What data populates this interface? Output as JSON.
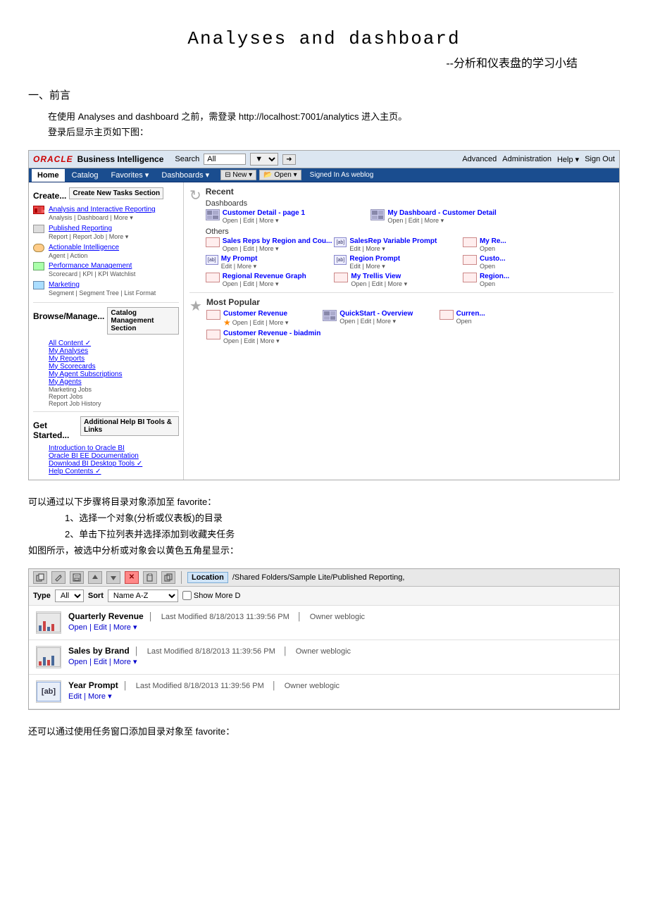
{
  "page": {
    "main_title": "Analyses and dashboard",
    "sub_title": "--分析和仪表盘的学习小结",
    "section1_heading": "一、前言",
    "body_text1": "在使用 Analyses and dashboard 之前，需登录 http://localhost:7001/analytics 进入主页。",
    "body_text2": "登录后显示主页如下图：",
    "body_text3": "可以通过以下步骤将目录对象添加至 favorite：",
    "list_item1": "1、选择一个对象(分析或仪表板)的目录",
    "list_item2": "2、单击下拉列表并选择添加到收藏夹任务",
    "body_text4": "如图所示，被选中分析或对象会以黄色五角星显示：",
    "body_text5": "还可以通过使用任务窗口添加目录对象至 favorite："
  },
  "bi_screenshot": {
    "logo": "ORACLE",
    "title": "Business Intelligence",
    "search_label": "Search",
    "search_placeholder": "All",
    "nav_links": [
      "Advanced",
      "Administration",
      "Help ▾",
      "Sign Out"
    ],
    "tabs": [
      "Home",
      "Catalog",
      "Favorites ▾",
      "Dashboards ▾"
    ],
    "nav_buttons": [
      "⊟ New ▾",
      "📂 Open ▾"
    ],
    "signed_as": "Signed In As weblog",
    "left_panel": {
      "create_title": "Create...",
      "create_btn": "Create New Tasks Section",
      "items": [
        {
          "icon": "analysis",
          "title": "Analysis and Interactive Reporting",
          "links": "Analysis | Dashboard | More ▾"
        },
        {
          "icon": "report",
          "title": "Published Reporting",
          "links": "Report | Report Job | More ▾"
        },
        {
          "icon": "agent",
          "title": "Actionable Intelligence",
          "links": "Agent | Action"
        },
        {
          "icon": "perf",
          "title": "Performance Management",
          "links": "Scorecard | KPI | KPI Watchlist"
        },
        {
          "icon": "marketing",
          "title": "Marketing",
          "links": "Segment | Segment Tree | List Format"
        }
      ],
      "browse_title": "Browse/Manage...",
      "browse_box": "Catalog Management Section",
      "browse_items": [
        "All Content ✓",
        "My Analyses",
        "My Reports",
        "My Scorecards",
        "My Agent Subscriptions",
        "My Agents",
        "Marketing Jobs",
        "Report Jobs",
        "Report Job History"
      ],
      "started_title": "Get Started...",
      "started_btn": "Additional Help BI Tools & Links",
      "started_items": [
        "Introduction to Oracle BI",
        "Oracle BI EE Documentation",
        "Download BI Desktop Tools ✓",
        "Help Contents ✓"
      ]
    },
    "right_panel": {
      "recent_title": "Recent",
      "dashboards_title": "Dashboards",
      "dashboards": [
        {
          "title": "Customer Detail - page 1",
          "links": "Open | Edit | More ▾"
        },
        {
          "title": "My Dashboard - Customer Detail",
          "links": "Open | Edit | More ▾"
        }
      ],
      "others_title": "Others",
      "others": [
        {
          "title": "Sales Reps by Region and Cou...",
          "links": "Open | Edit | More ▾"
        },
        {
          "title": "SalesRep Variable Prompt",
          "links": "Edit | More ▾"
        },
        {
          "title": "My Prompt",
          "links": "Edit | More ▾"
        },
        {
          "title": "Region Prompt",
          "links": "Edit | More ▾"
        },
        {
          "title": "Regional Revenue Graph",
          "links": "Open | Edit | More ▾"
        },
        {
          "title": "My Trellis View",
          "links": "Open | Edit | More ▾"
        },
        {
          "title": "My Re...",
          "links": "Open"
        },
        {
          "title": "Custo...",
          "links": "Open"
        },
        {
          "title": "Region...",
          "links": "Open"
        }
      ],
      "popular_title": "Most Popular",
      "popular": [
        {
          "title": "Customer Revenue",
          "links": "Open | Edit | More ▾"
        },
        {
          "title": "QuickStart - Overview",
          "links": "Open | Edit | More ▾"
        },
        {
          "title": "Curren...",
          "links": "Open"
        },
        {
          "title": "Customer Revenue - biadmin",
          "links": "Open | Edit | More ▾"
        }
      ]
    }
  },
  "catalog_screenshot": {
    "toolbar_icons": [
      "copy",
      "edit",
      "save",
      "up",
      "down",
      "delete",
      "paste",
      "copy2"
    ],
    "location_label": "Location",
    "location_path": "/Shared Folders/Sample Lite/Published Reporting,",
    "type_label": "Type",
    "type_value": "All",
    "sort_label": "Sort",
    "sort_value": "Name A-Z",
    "show_more_label": "Show More D",
    "items": [
      {
        "title": "Quarterly Revenue",
        "meta": "Last Modified 8/18/2013 11:39:56 PM",
        "owner": "Owner weblogic",
        "links": "Open | Edit | More ▾",
        "icon_type": "bar"
      },
      {
        "title": "Sales by Brand",
        "meta": "Last Modified 8/18/2013 11:39:56 PM",
        "owner": "Owner weblogic",
        "links": "Open | Edit | More ▾",
        "icon_type": "bar"
      },
      {
        "title": "Year Prompt",
        "meta": "Last Modified 8/18/2013 11:39:56 PM",
        "owner": "Owner weblogic",
        "links": "Edit | More ▾",
        "icon_type": "ab"
      }
    ]
  }
}
